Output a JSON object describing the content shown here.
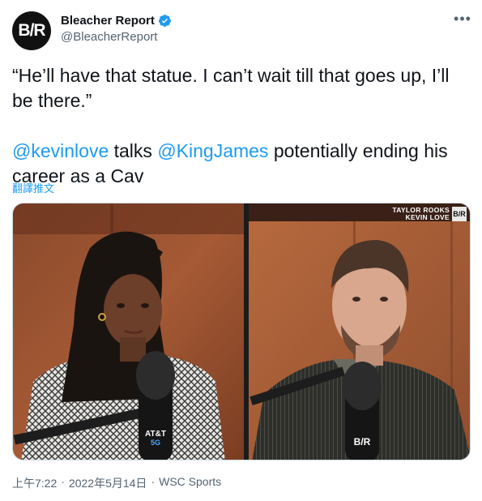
{
  "account": {
    "avatar_text": "B/R",
    "display_name": "Bleacher Report",
    "handle": "@BleacherReport",
    "verified": true
  },
  "tweet": {
    "quote": "“He’ll have that statue. I can’t wait till that goes up, I’ll be there.”",
    "mention1": "@kevinlove",
    "text1": " talks ",
    "mention2": "@KingJames",
    "text2": " potentially ending his career as a Cav",
    "translate": "翻譯推文"
  },
  "media": {
    "overlay_line1": "TAYLOR ROOKS",
    "overlay_line2": "KEVIN LOVE",
    "overlay_logo": "B/R",
    "mic_label": "AT&T",
    "mic_sub": "5G",
    "mic2_label": "B/R"
  },
  "meta": {
    "time": "上午7:22",
    "sep1": "·",
    "date": "2022年5月14日",
    "sep2": "·",
    "source": "WSC Sports"
  },
  "colors": {
    "link": "#1d9bf0",
    "text": "#0f1419",
    "muted": "#536471"
  }
}
